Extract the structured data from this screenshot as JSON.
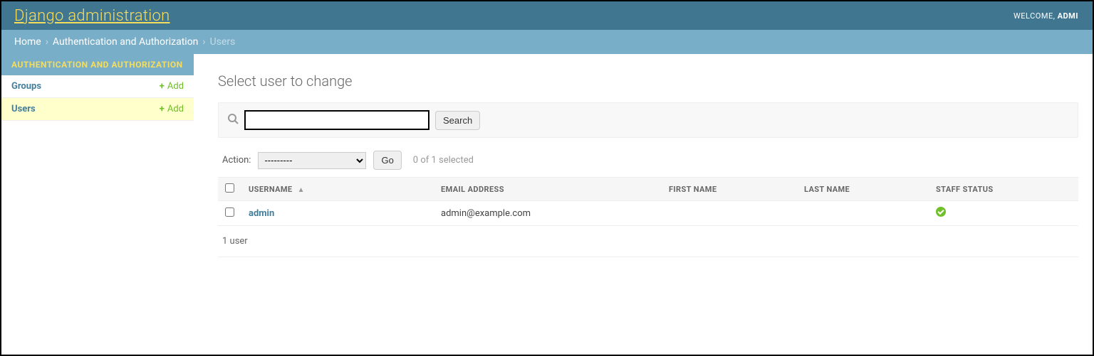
{
  "header": {
    "site_title": "Django administration",
    "welcome_prefix": "WELCOME, ",
    "welcome_user": "ADMI"
  },
  "breadcrumbs": {
    "home": "Home",
    "app": "Authentication and Authorization",
    "current": "Users"
  },
  "sidebar": {
    "caption": "AUTHENTICATION AND AUTHORIZATION",
    "items": [
      {
        "label": "Groups",
        "add": "Add",
        "selected": false
      },
      {
        "label": "Users",
        "add": "Add",
        "selected": true
      }
    ]
  },
  "content": {
    "title": "Select user to change",
    "search_button": "Search",
    "action_label": "Action:",
    "action_placeholder": "---------",
    "go_label": "Go",
    "selection_counter": "0 of 1 selected",
    "columns": {
      "username": "USERNAME",
      "email": "EMAIL ADDRESS",
      "first": "FIRST NAME",
      "last": "LAST NAME",
      "staff": "STAFF STATUS"
    },
    "rows": [
      {
        "username": "admin",
        "email": "admin@example.com",
        "first": "",
        "last": "",
        "staff": true
      }
    ],
    "paginator": "1 user"
  }
}
